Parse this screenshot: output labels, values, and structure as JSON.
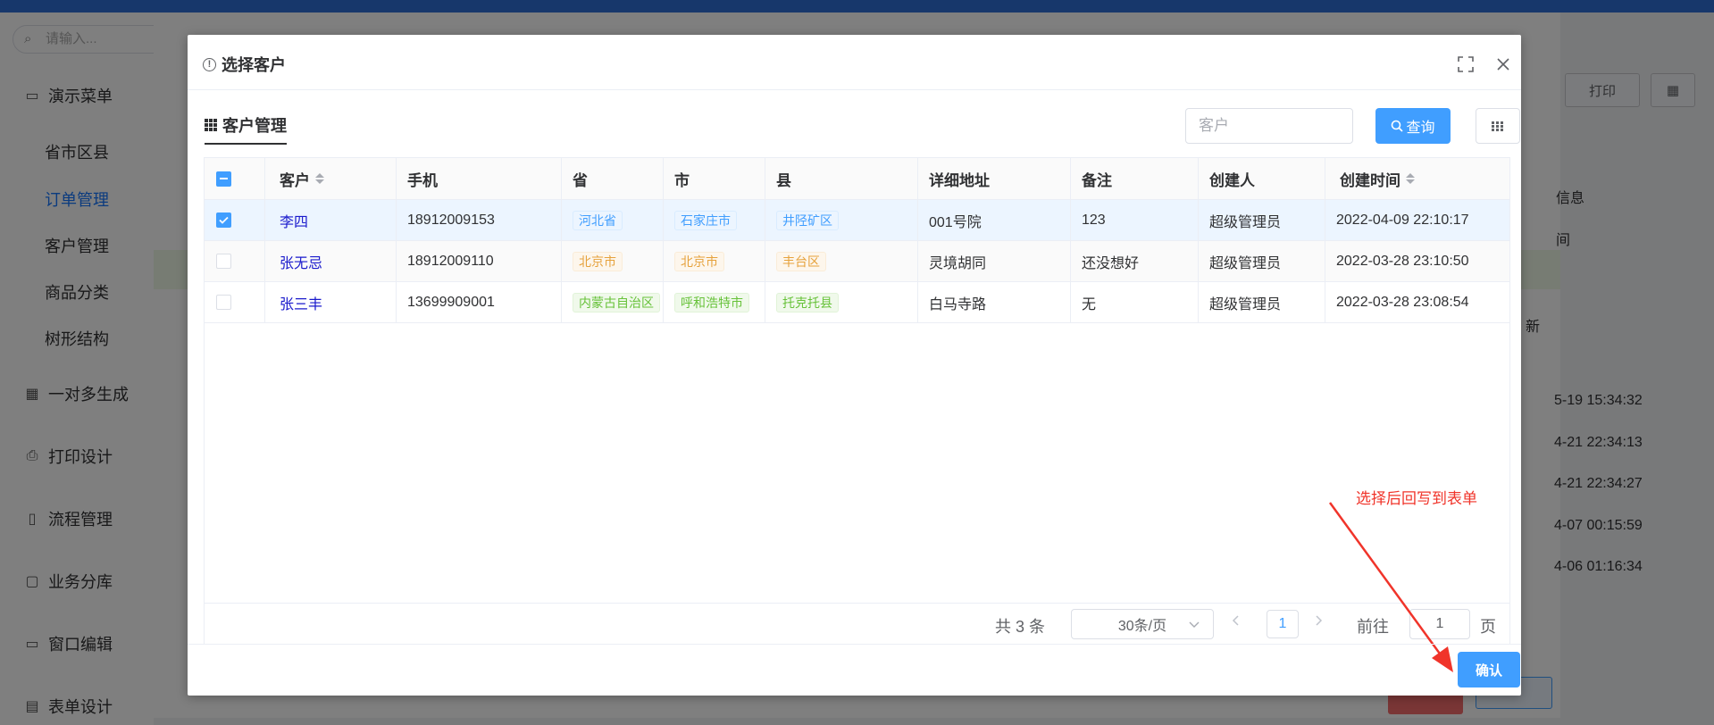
{
  "background": {
    "search_placeholder": "请输入...",
    "menu": [
      {
        "label": "演示菜单",
        "icon": "monitor-icon"
      },
      {
        "label": "一对多生成",
        "icon": "calendar-icon"
      },
      {
        "label": "打印设计",
        "icon": "printer-icon"
      },
      {
        "label": "流程管理",
        "icon": "flow-icon"
      },
      {
        "label": "业务分库",
        "icon": "folder-icon"
      },
      {
        "label": "窗口编辑",
        "icon": "window-icon"
      },
      {
        "label": "表单设计",
        "icon": "form-icon"
      }
    ],
    "submenu": [
      "省市区县",
      "订单管理",
      "客户管理",
      "商品分类",
      "树形结构"
    ],
    "active_submenu": "订单管理",
    "print_button": "打印",
    "partial_text": [
      "信息",
      "间",
      "新"
    ],
    "timestamps": [
      "5-19 15:34:32",
      "4-21 22:34:13",
      "4-21 22:34:27",
      "4-07 00:15:59",
      "4-06 01:16:34"
    ]
  },
  "dialog": {
    "title": "选择客户",
    "tab": "客户管理",
    "search_placeholder": "客户",
    "query_button": "查询",
    "columns": [
      "客户",
      "手机",
      "省",
      "市",
      "县",
      "详细地址",
      "备注",
      "创建人",
      "创建时间"
    ],
    "rows": [
      {
        "customer": "李四",
        "phone": "18912009153",
        "province": "河北省",
        "city": "石家庄市",
        "county": "井陉矿区",
        "address": "001号院",
        "remark": "123",
        "creator": "超级管理员",
        "created": "2022-04-09 22:10:17",
        "checked": true,
        "tag_color": "blue"
      },
      {
        "customer": "张无忌",
        "phone": "18912009110",
        "province": "北京市",
        "city": "北京市",
        "county": "丰台区",
        "address": "灵境胡同",
        "remark": "还没想好",
        "creator": "超级管理员",
        "created": "2022-03-28 23:10:50",
        "checked": false,
        "tag_color": "orange"
      },
      {
        "customer": "张三丰",
        "phone": "13699909001",
        "province": "内蒙古自治区",
        "city": "呼和浩特市",
        "county": "托克托县",
        "address": "白马寺路",
        "remark": "无",
        "creator": "超级管理员",
        "created": "2022-03-28 23:08:54",
        "checked": false,
        "tag_color": "green"
      }
    ],
    "pagination": {
      "total_label": "共 3 条",
      "page_size": "30条/页",
      "current_page": "1",
      "goto_label": "前往",
      "goto_value": "1",
      "page_label": "页"
    },
    "annotation": "选择后回写到表单",
    "confirm_button": "确认"
  },
  "colors": {
    "primary": "#409eff",
    "annotation": "#f0342a",
    "link": "#1a1acc"
  }
}
